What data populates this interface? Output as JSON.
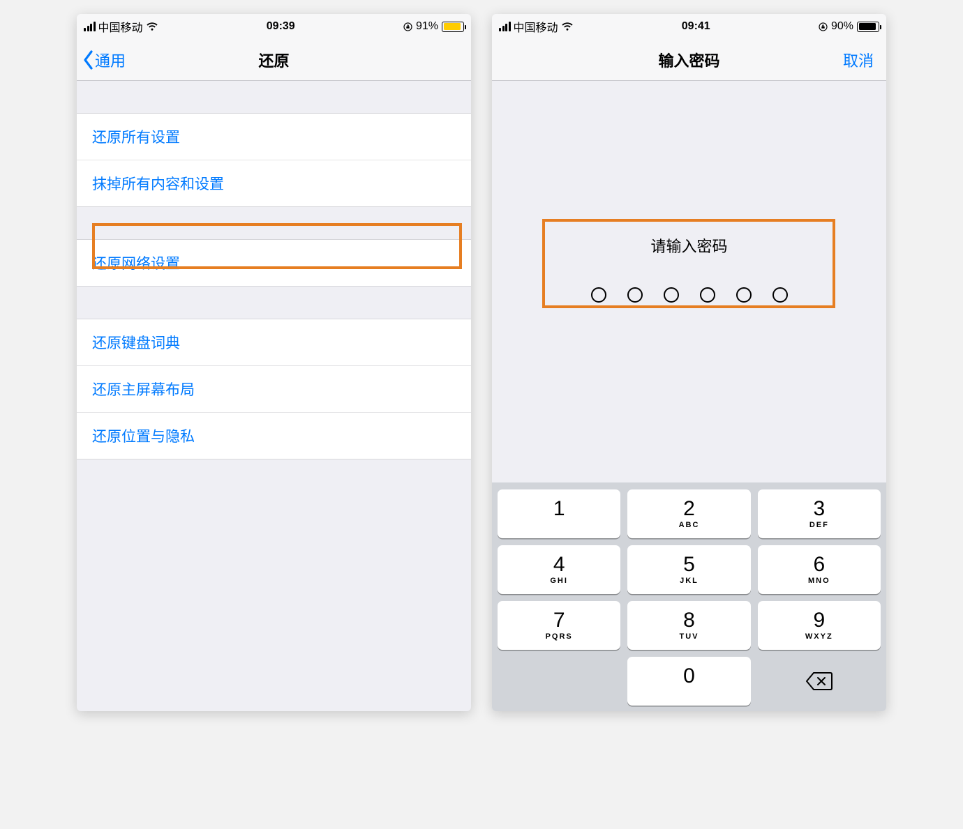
{
  "left": {
    "status": {
      "carrier": "中国移动",
      "time": "09:39",
      "battery_pct": "91%"
    },
    "nav": {
      "back": "通用",
      "title": "还原"
    },
    "group1": [
      {
        "label": "还原所有设置"
      },
      {
        "label": "抹掉所有内容和设置"
      }
    ],
    "group2": [
      {
        "label": "还原网络设置"
      }
    ],
    "group3": [
      {
        "label": "还原键盘词典"
      },
      {
        "label": "还原主屏幕布局"
      },
      {
        "label": "还原位置与隐私"
      }
    ]
  },
  "right": {
    "status": {
      "carrier": "中国移动",
      "time": "09:41",
      "battery_pct": "90%"
    },
    "nav": {
      "title": "输入密码",
      "cancel": "取消"
    },
    "prompt": "请输入密码",
    "passcode_length": 6,
    "keypad": [
      {
        "d": "1",
        "l": ""
      },
      {
        "d": "2",
        "l": "ABC"
      },
      {
        "d": "3",
        "l": "DEF"
      },
      {
        "d": "4",
        "l": "GHI"
      },
      {
        "d": "5",
        "l": "JKL"
      },
      {
        "d": "6",
        "l": "MNO"
      },
      {
        "d": "7",
        "l": "PQRS"
      },
      {
        "d": "8",
        "l": "TUV"
      },
      {
        "d": "9",
        "l": "WXYZ"
      }
    ],
    "zero": {
      "d": "0",
      "l": ""
    }
  }
}
